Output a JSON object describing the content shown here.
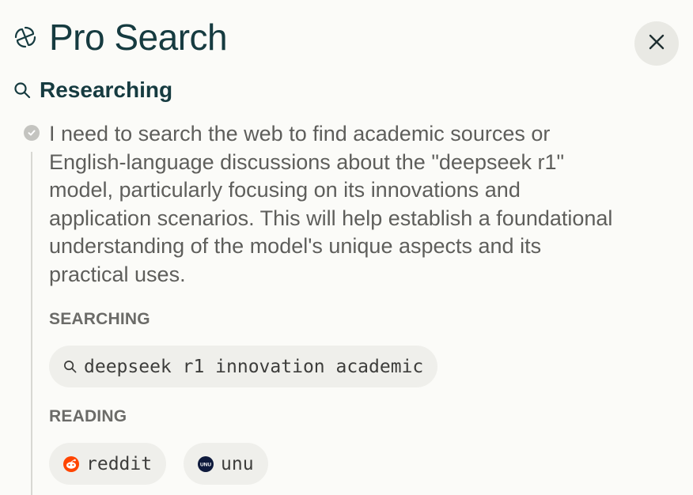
{
  "header": {
    "title": "Pro Search",
    "logo_icon": "perplexity-logo-icon",
    "close_icon": "close-icon"
  },
  "step": {
    "title": "Researching",
    "icon": "search-icon",
    "status_icon": "check-circle-icon",
    "description": "I need to search the web to find academic sources or English-language discussions about the \"deepseek r1\" model, particularly focusing on its innovations and application scenarios. This will help establish a foundational understanding of the model's unique aspects and its practical uses."
  },
  "searching": {
    "label": "SEARCHING",
    "queries": [
      {
        "text": "deepseek r1 innovation academic",
        "icon": "search-icon"
      }
    ]
  },
  "reading": {
    "label": "READING",
    "sources": [
      {
        "name": "reddit",
        "icon": "reddit-icon",
        "color": "#ff4500"
      },
      {
        "name": "unu",
        "icon": "unu-icon",
        "color": "#0e1a3c",
        "logo_text": "UNU"
      }
    ]
  },
  "colors": {
    "background": "#fbfbf8",
    "title": "#163b40",
    "body_text": "#5e5e5b",
    "chip_bg": "#efefeb",
    "close_bg": "#e9e9e4"
  }
}
